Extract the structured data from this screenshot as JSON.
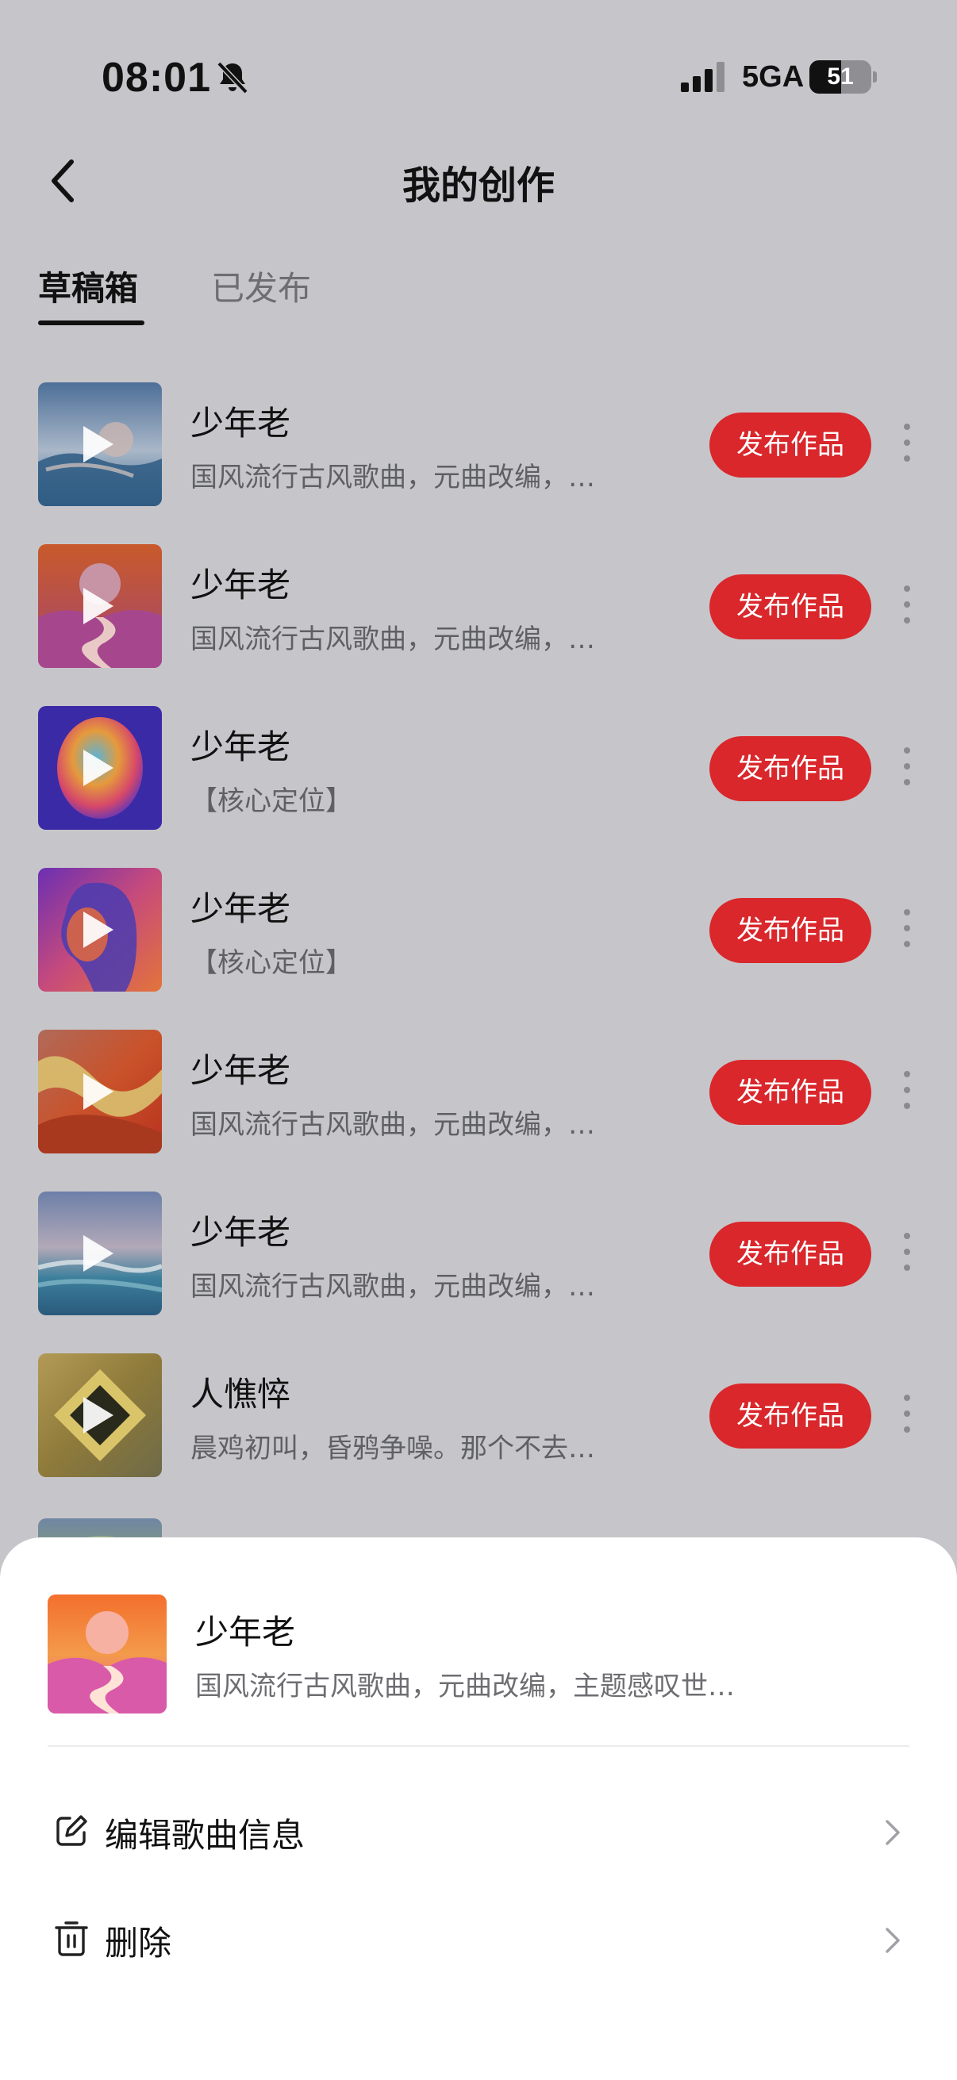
{
  "status_bar": {
    "time": "08:01",
    "network": "5GA",
    "battery": "51",
    "battery_level": 0.51
  },
  "nav": {
    "title": "我的创作"
  },
  "tabs": [
    {
      "label": "草稿箱",
      "active": true
    },
    {
      "label": "已发布",
      "active": false
    }
  ],
  "publish_label": "发布作品",
  "songs": [
    {
      "title": "少年老",
      "desc": "国风流行古风歌曲，元曲改编，…",
      "cover": "blue-sea-mountains"
    },
    {
      "title": "少年老",
      "desc": "国风流行古风歌曲，元曲改编，…",
      "cover": "sunset-river"
    },
    {
      "title": "少年老",
      "desc": "【核心定位】",
      "cover": "iridescent-oval"
    },
    {
      "title": "少年老",
      "desc": "【核心定位】",
      "cover": "purple-portrait"
    },
    {
      "title": "少年老",
      "desc": "国风流行古风歌曲，元曲改编，…",
      "cover": "orange-waves"
    },
    {
      "title": "少年老",
      "desc": "国风流行古风歌曲，元曲改编，…",
      "cover": "sea-sky"
    },
    {
      "title": "人憔悴",
      "desc": "晨鸡初叫，昏鸦争噪。那个不去…",
      "cover": "dark-diamond"
    }
  ],
  "sheet": {
    "title": "少年老",
    "desc": "国风流行古风歌曲，元曲改编，主题感叹世…",
    "actions": [
      {
        "label": "编辑歌曲信息",
        "icon": "edit-icon"
      },
      {
        "label": "删除",
        "icon": "trash-icon"
      }
    ]
  },
  "colors": {
    "accent": "#d9272b",
    "overlay": "#c6c6ca",
    "sheet": "#ffffff"
  }
}
